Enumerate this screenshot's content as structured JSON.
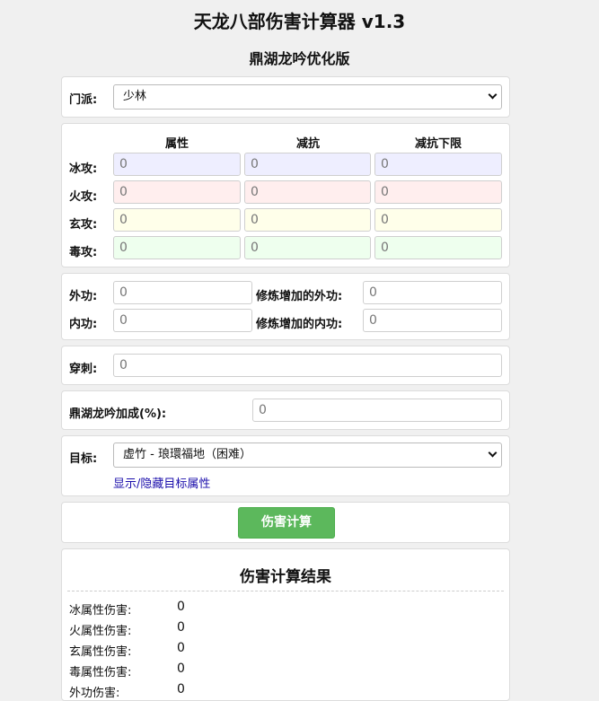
{
  "header": {
    "title": "天龙八部伤害计算器 v1.3",
    "subtitle": "鼎湖龙吟优化版"
  },
  "sect": {
    "label": "门派:",
    "value": "少林"
  },
  "attributes": {
    "col_headers": [
      "属性",
      "减抗",
      "减抗下限"
    ],
    "rows": [
      {
        "label": "冰攻:",
        "values": [
          "0",
          "0",
          "0"
        ],
        "cls": "ice"
      },
      {
        "label": "火攻:",
        "values": [
          "0",
          "0",
          "0"
        ],
        "cls": "fire"
      },
      {
        "label": "玄攻:",
        "values": [
          "0",
          "0",
          "0"
        ],
        "cls": "mys"
      },
      {
        "label": "毒攻:",
        "values": [
          "0",
          "0",
          "0"
        ],
        "cls": "poi"
      }
    ]
  },
  "attack": {
    "outer_label": "外功:",
    "outer_value": "0",
    "outer_bonus_label": "修炼增加的外功:",
    "outer_bonus_value": "0",
    "inner_label": "内功:",
    "inner_value": "0",
    "inner_bonus_label": "修炼增加的内功:",
    "inner_bonus_value": "0"
  },
  "pierce": {
    "label": "穿刺:",
    "value": "0"
  },
  "bonus": {
    "label": "鼎湖龙吟加成(%):",
    "value": "0"
  },
  "target": {
    "label": "目标:",
    "value": "虚竹 - 琅環福地（困难）",
    "toggle_link": "显示/隐藏目标属性"
  },
  "calc": {
    "button_label": "伤害计算"
  },
  "results": {
    "title": "伤害计算结果",
    "rows": [
      {
        "label": "冰属性伤害:",
        "value": "0"
      },
      {
        "label": "火属性伤害:",
        "value": "0"
      },
      {
        "label": "玄属性伤害:",
        "value": "0"
      },
      {
        "label": "毒属性伤害:",
        "value": "0"
      },
      {
        "label": "外功伤害:",
        "value": "0"
      }
    ]
  }
}
